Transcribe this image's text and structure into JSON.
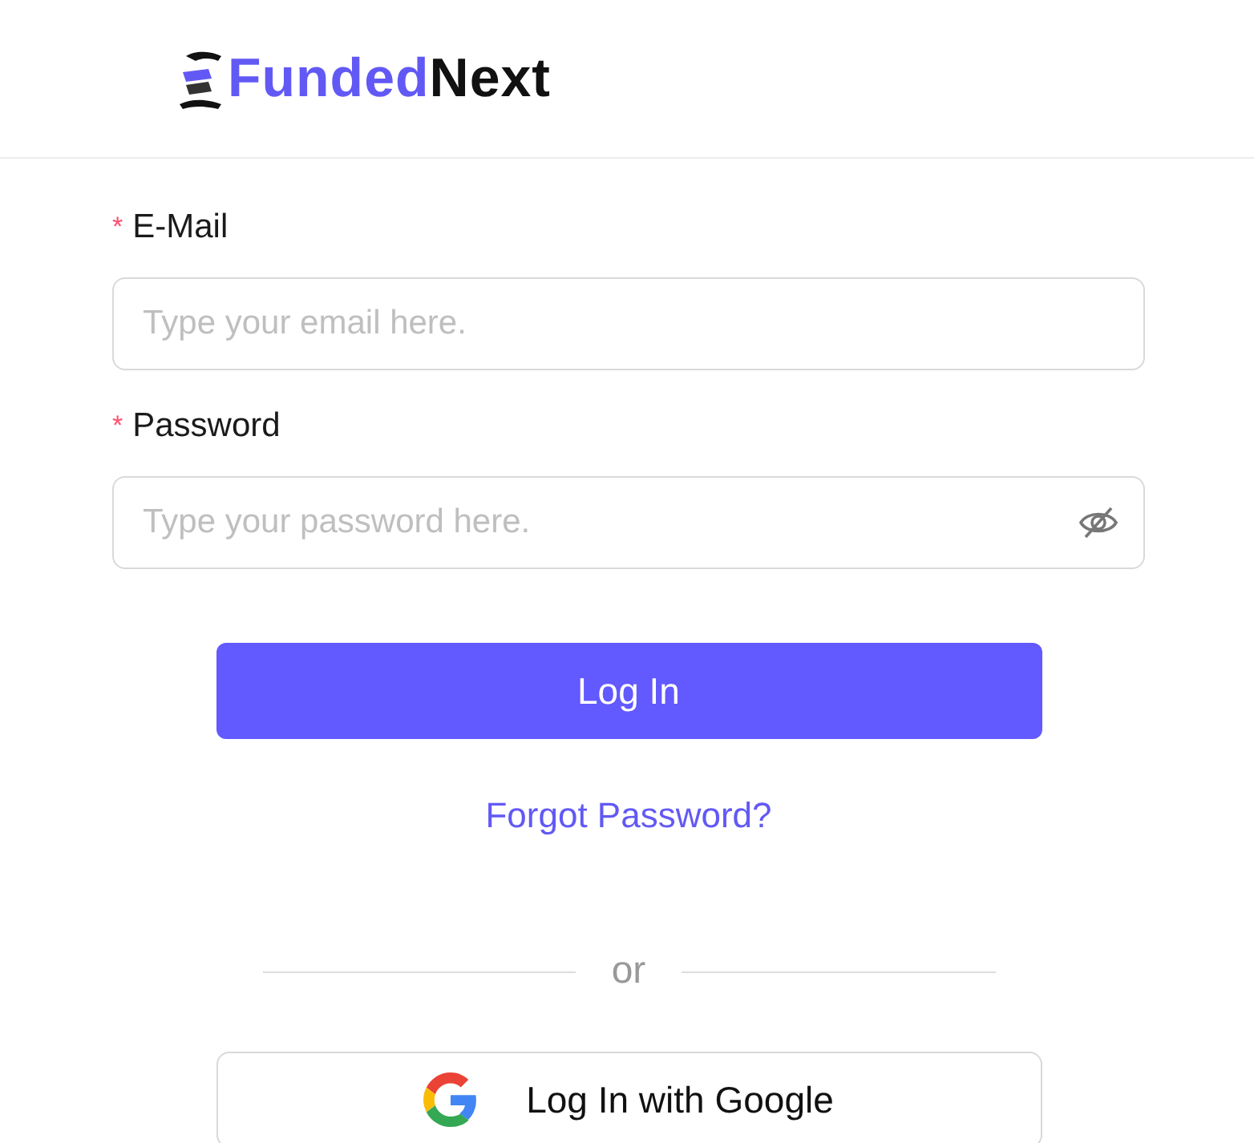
{
  "logo": {
    "part_1": "Funded",
    "part_2": "Next"
  },
  "fields": [
    {
      "label": "E-Mail",
      "required_mark": "*",
      "placeholder": "Type your email here.",
      "kind": "text"
    },
    {
      "label": "Password",
      "required_mark": "*",
      "placeholder": "Type your password here.",
      "kind": "password"
    }
  ],
  "login_button": "Log In",
  "forgot_link": "Forgot Password?",
  "divider_text": "or",
  "google_button": "Log In with Google"
}
